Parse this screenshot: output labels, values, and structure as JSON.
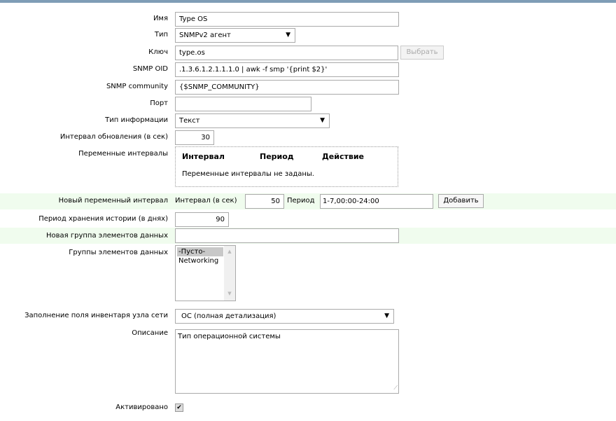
{
  "form": {
    "name": {
      "label": "Имя",
      "value": "Type OS"
    },
    "type": {
      "label": "Тип",
      "value": "SNMPv2 агент"
    },
    "key": {
      "label": "Ключ",
      "value": "type.os",
      "button": "Выбрать"
    },
    "oid": {
      "label": "SNMP OID",
      "value": ".1.3.6.1.2.1.1.1.0 | awk -f smp '{print $2}'"
    },
    "community": {
      "label": "SNMP community",
      "value": "{$SNMP_COMMUNITY}"
    },
    "port": {
      "label": "Порт",
      "value": ""
    },
    "info_type": {
      "label": "Тип информации",
      "value": "Текст"
    },
    "interval": {
      "label": "Интервал обновления (в сек)",
      "value": "30"
    },
    "flex": {
      "label": "Переменные интервалы",
      "headers": [
        "Интервал",
        "Период",
        "Действие"
      ],
      "empty": "Переменные интервалы не заданы."
    },
    "new_flex": {
      "label": "Новый переменный интервал",
      "interval_label": "Интервал (в сек)",
      "interval_value": "50",
      "period_label": "Период",
      "period_value": "1-7,00:00-24:00",
      "button": "Добавить"
    },
    "history": {
      "label": "Период хранения истории (в днях)",
      "value": "90"
    },
    "new_app": {
      "label": "Новая группа элементов данных",
      "value": ""
    },
    "apps": {
      "label": "Группы элементов данных",
      "options": [
        "-Пусто-",
        "Networking"
      ],
      "selected": "-Пусто-"
    },
    "inventory": {
      "label": "Заполнение поля инвентаря узла сети",
      "value": "ОС (полная детализация)"
    },
    "description": {
      "label": "Описание",
      "value": "Тип операционной системы"
    },
    "enabled": {
      "label": "Активировано",
      "checked": true
    }
  }
}
